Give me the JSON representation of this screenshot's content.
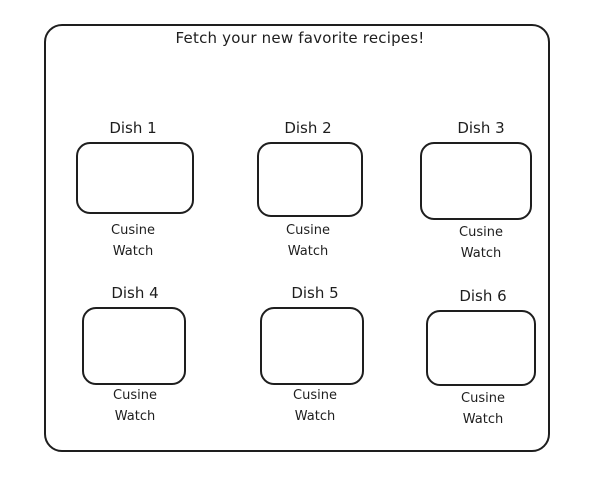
{
  "header": {
    "title": "Fetch your new favorite recipes!"
  },
  "dishes": [
    {
      "name": "Dish 1",
      "cuisine": "Cusine",
      "watch": "Watch"
    },
    {
      "name": "Dish 2",
      "cuisine": "Cusine",
      "watch": "Watch"
    },
    {
      "name": "Dish 3",
      "cuisine": "Cusine",
      "watch": "Watch"
    },
    {
      "name": "Dish 4",
      "cuisine": "Cusine",
      "watch": "Watch"
    },
    {
      "name": "Dish 5",
      "cuisine": "Cusine",
      "watch": "Watch"
    },
    {
      "name": "Dish 6",
      "cuisine": "Cusine",
      "watch": "Watch"
    }
  ],
  "colors": {
    "stroke": "#1e1e1e",
    "background": "#ffffff"
  }
}
